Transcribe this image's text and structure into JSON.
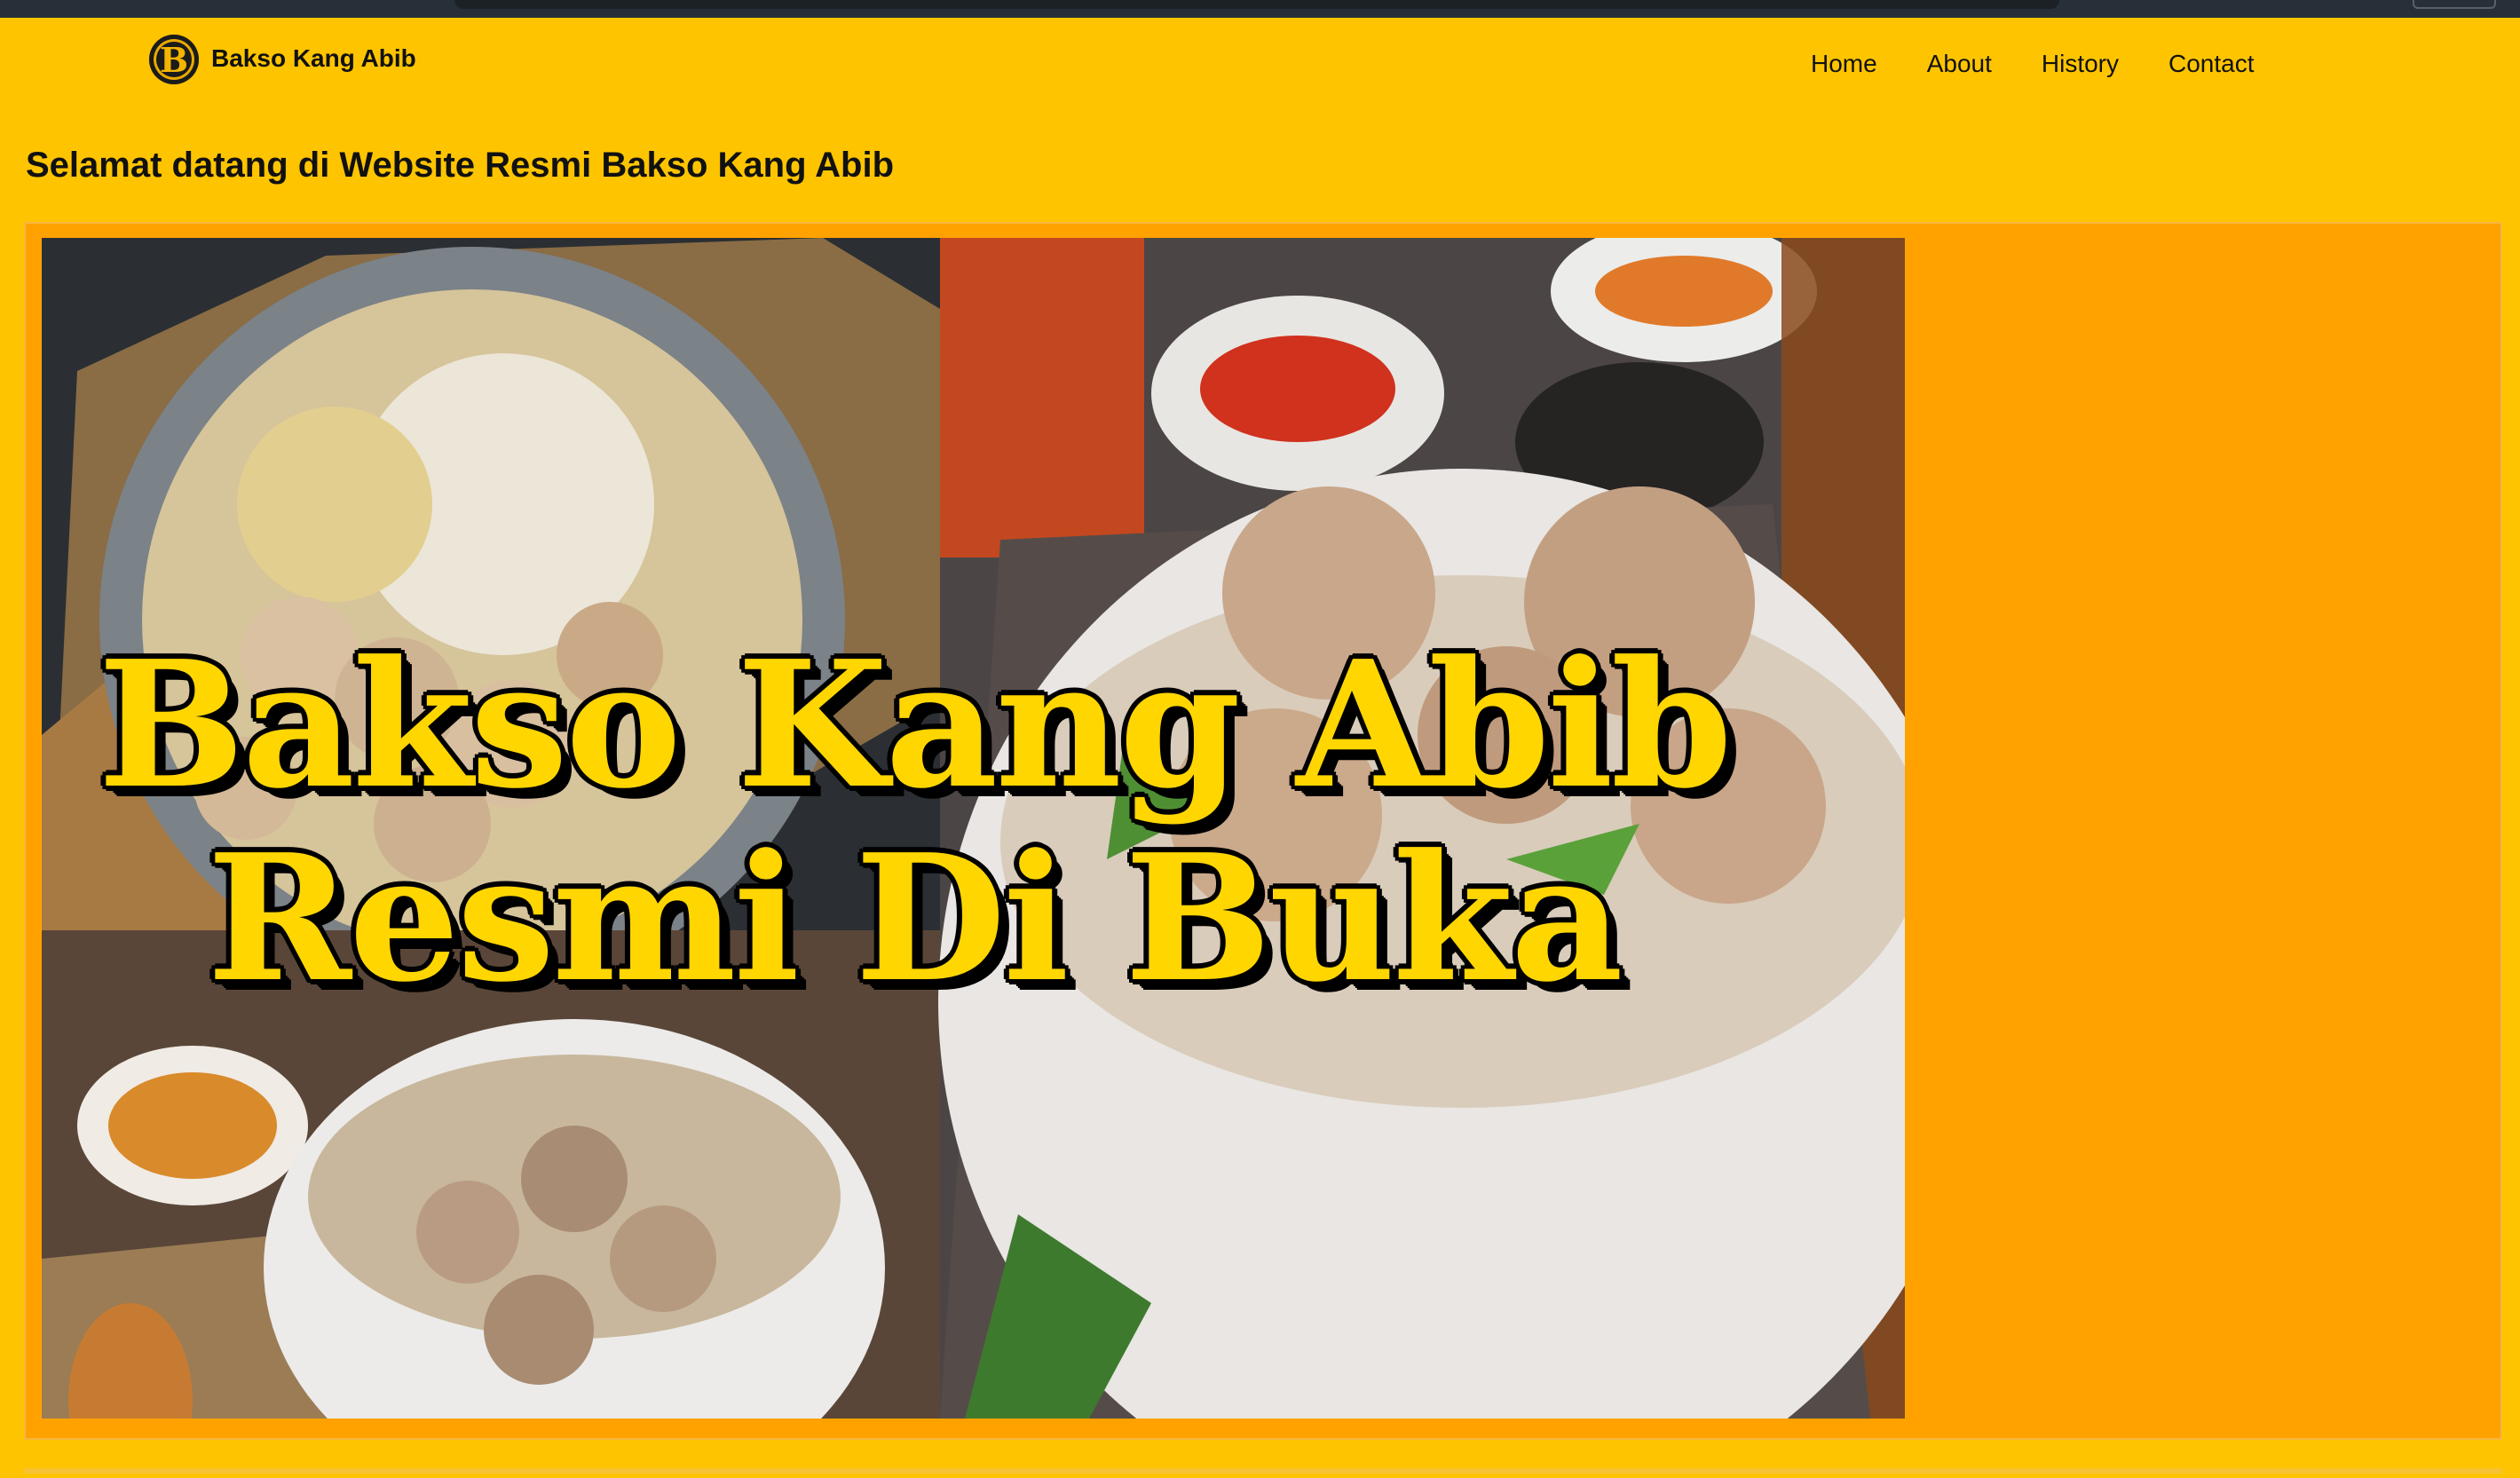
{
  "site": {
    "logo_letter": "B",
    "brand_name": "Bakso Kang Abib"
  },
  "nav": {
    "items": [
      {
        "label": "Home"
      },
      {
        "label": "About"
      },
      {
        "label": "History"
      },
      {
        "label": "Contact"
      }
    ]
  },
  "main": {
    "welcome_heading": "Selamat datang di Website Resmi Bakso Kang Abib",
    "hero": {
      "line1": "Bakso Kang Abib",
      "line2": "Resmi Di Buka"
    }
  },
  "colors": {
    "page_background": "#ffc400",
    "panel_background": "#ffa200",
    "hero_text": "#ffd600"
  }
}
